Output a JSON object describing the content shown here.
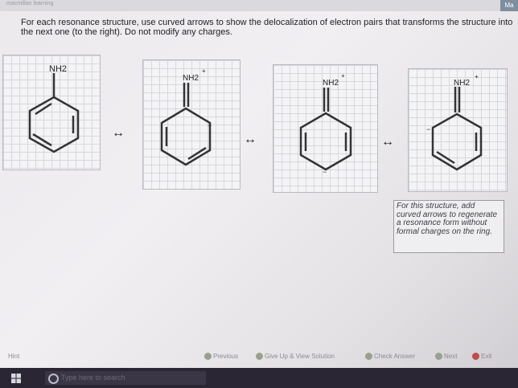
{
  "app": {
    "brand": "macmillan learning",
    "corner_label": "Ma"
  },
  "instructions": "For each resonance structure, use curved arrows to show the delocalization of electron pairs that transforms the structure into the next one (to the right). Do not modify any charges.",
  "structures": [
    {
      "group_label": "NH2",
      "charge": ""
    },
    {
      "group_label": "NH2",
      "charge": "+"
    },
    {
      "group_label": "NH2",
      "charge": "+"
    },
    {
      "group_label": "NH2",
      "charge": "+"
    }
  ],
  "resonance_arrow": "↔",
  "note": "For this structure, add curved arrows to regenerate a resonance form without formal charges on the ring.",
  "navigation": {
    "left_label": "Hint",
    "previous": "Previous",
    "give_up": "Give Up & View Solution",
    "check": "Check Answer",
    "next": "Next",
    "exit": "Exit"
  },
  "taskbar": {
    "search_placeholder": "Type here to search"
  },
  "colors": {
    "taskbar": "#2a2633",
    "accent": "#7f8e9f"
  }
}
